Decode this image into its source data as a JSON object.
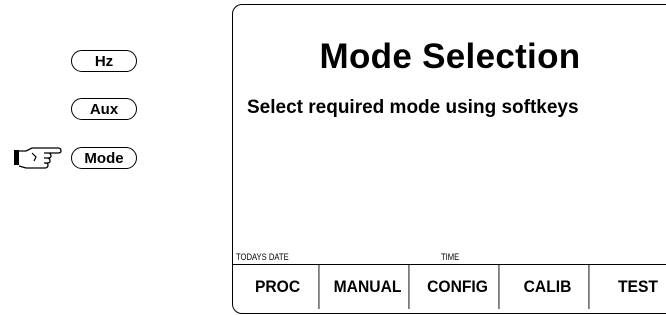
{
  "side_keys": {
    "hz": "Hz",
    "aux": "Aux",
    "mode": "Mode"
  },
  "screen": {
    "title": "Mode Selection",
    "subtitle": "Select required mode using softkeys",
    "date_label": "TODAYS DATE",
    "time_label": "TIME"
  },
  "softkeys": [
    "PROC",
    "MANUAL",
    "CONFIG",
    "CALIB",
    "TEST"
  ],
  "icons": {
    "pointer": "pointing-hand-icon"
  }
}
